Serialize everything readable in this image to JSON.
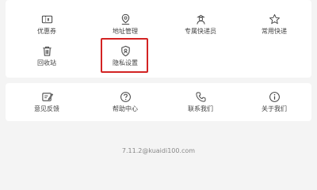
{
  "tools": [
    {
      "label": "优惠券",
      "icon": "ticket-icon"
    },
    {
      "label": "地址管理",
      "icon": "location-pin-icon"
    },
    {
      "label": "专属快递员",
      "icon": "courier-icon"
    },
    {
      "label": "常用快递",
      "icon": "star-icon"
    },
    {
      "label": "回收站",
      "icon": "trash-icon"
    },
    {
      "label": "隐私设置",
      "icon": "shield-icon"
    }
  ],
  "support": [
    {
      "label": "意见反馈",
      "icon": "feedback-icon"
    },
    {
      "label": "帮助中心",
      "icon": "help-icon"
    },
    {
      "label": "联系我们",
      "icon": "phone-icon"
    },
    {
      "label": "关于我们",
      "icon": "info-icon"
    }
  ],
  "highlight_color": "#d32323",
  "footer": {
    "version_text": "7.11.2@kuaidi100.com"
  }
}
